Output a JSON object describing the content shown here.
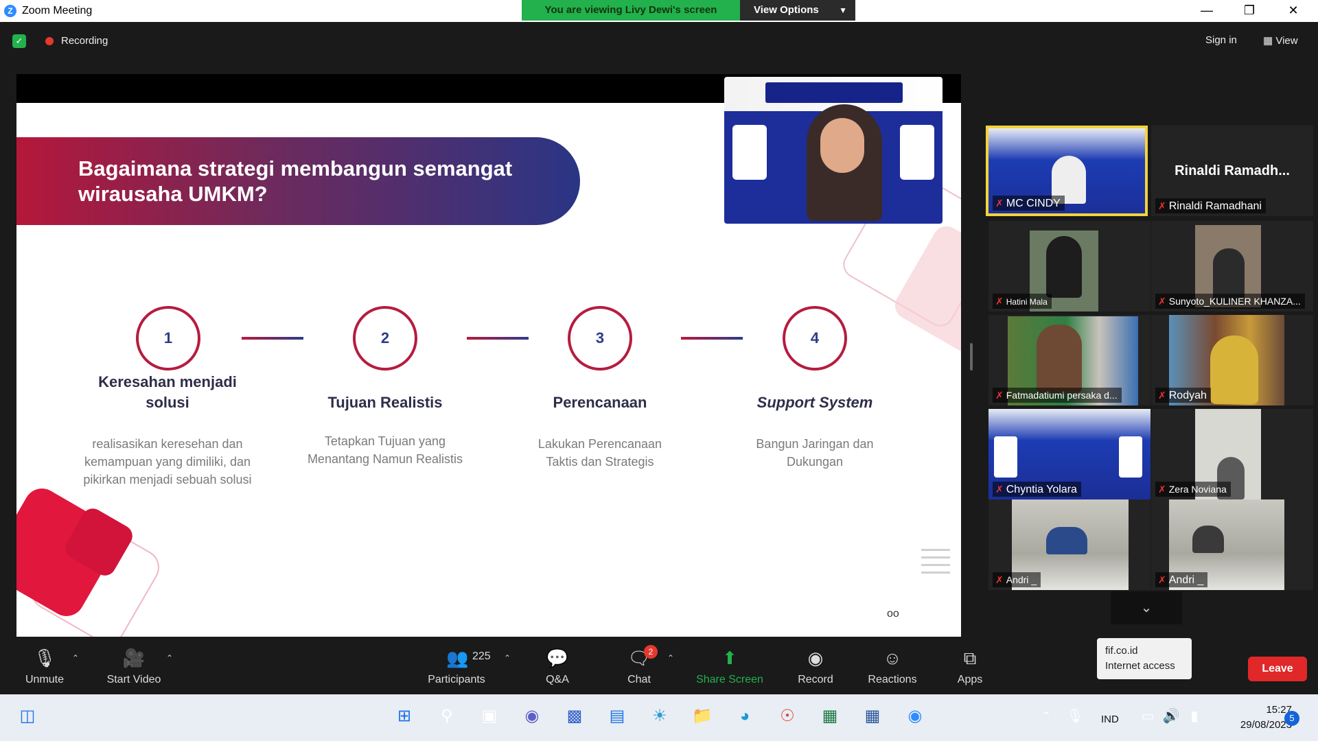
{
  "window": {
    "title": "Zoom Meeting",
    "viewing_banner": "You are viewing Livy Dewi's screen",
    "view_options": "View Options"
  },
  "topbar": {
    "recording": "Recording",
    "sign_in": "Sign in",
    "view": "View"
  },
  "slide": {
    "title": "Bagaimana strategi membangun semangat wirausaha UMKM?",
    "steps": [
      {
        "number": "1",
        "title": "Keresahan menjadi solusi",
        "desc": "realisasikan keresehan dan kemampuan yang dimiliki, dan pikirkan menjadi sebuah solusi"
      },
      {
        "number": "2",
        "title": "Tujuan Realistis",
        "desc": "Tetapkan Tujuan yang Menantang Namun Realistis"
      },
      {
        "number": "3",
        "title": "Perencanaan",
        "desc": "Lakukan Perencanaan Taktis dan Strategis"
      },
      {
        "number": "4",
        "title": "Support System",
        "desc": "Bangun Jaringan dan Dukungan"
      }
    ],
    "dots": "oo"
  },
  "participants": [
    {
      "name": "MC CINDY",
      "active": true
    },
    {
      "name": "Rinaldi Ramadhani",
      "big_name": "Rinaldi  Ramadh..."
    },
    {
      "name": "Hatini Mala"
    },
    {
      "name": "Sunyoto_KULINER KHANZA..."
    },
    {
      "name": "Fatmadatiumi persaka d..."
    },
    {
      "name": "Rodyah"
    },
    {
      "name": "Chyntia Yolara"
    },
    {
      "name": "Zera Noviana"
    },
    {
      "name": "Andri _"
    },
    {
      "name": "Andri _"
    }
  ],
  "toolbar": {
    "unmute": "Unmute",
    "start_video": "Start Video",
    "participants": "Participants",
    "participant_count": "225",
    "qa": "Q&A",
    "chat": "Chat",
    "chat_badge": "2",
    "share_screen": "Share Screen",
    "record": "Record",
    "reactions": "Reactions",
    "apps": "Apps",
    "leave": "Leave"
  },
  "tooltip": {
    "line1": "fif.co.id",
    "line2": "Internet access"
  },
  "taskbar": {
    "lang": "IND",
    "time": "15:27",
    "date": "29/08/2023",
    "notifications": "5",
    "icons": [
      "windows-start",
      "search",
      "task-view",
      "teams-chat",
      "zoom-workplace",
      "notepad",
      "weather",
      "file-explorer",
      "edge",
      "chrome",
      "excel",
      "word",
      "zoom"
    ]
  },
  "colors": {
    "accent_green": "#22b14c",
    "leave_red": "#e02828",
    "active_border": "#f3d33c",
    "slide_red": "#b51c3f",
    "slide_blue": "#2d3c88"
  }
}
